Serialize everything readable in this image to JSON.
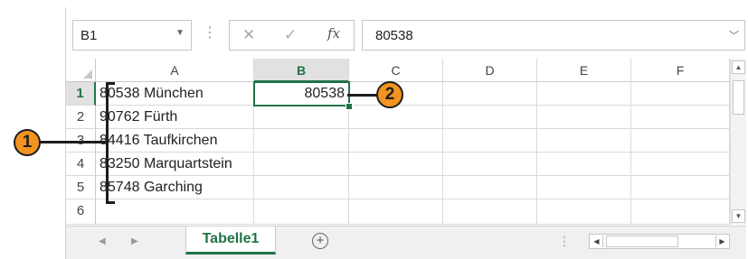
{
  "formula_bar": {
    "name_box": "B1",
    "formula_value": "80538",
    "cancel_glyph": "✕",
    "confirm_glyph": "✓",
    "fx_glyph": "fx"
  },
  "columns": [
    "A",
    "B",
    "C",
    "D",
    "E",
    "F"
  ],
  "active_column": "B",
  "rows": [
    {
      "num": "1",
      "a": "80538 München",
      "b": "80538"
    },
    {
      "num": "2",
      "a": "90762 Fürth",
      "b": ""
    },
    {
      "num": "3",
      "a": "84416 Taufkirchen",
      "b": ""
    },
    {
      "num": "4",
      "a": "83250 Marquartstein",
      "b": ""
    },
    {
      "num": "5",
      "a": "85748 Garching",
      "b": ""
    },
    {
      "num": "6",
      "a": "",
      "b": ""
    }
  ],
  "sheet_tabs": [
    "Tabelle1"
  ],
  "callouts": [
    "1",
    "2"
  ],
  "colors": {
    "accent": "#217346",
    "callout": "#f39320"
  }
}
